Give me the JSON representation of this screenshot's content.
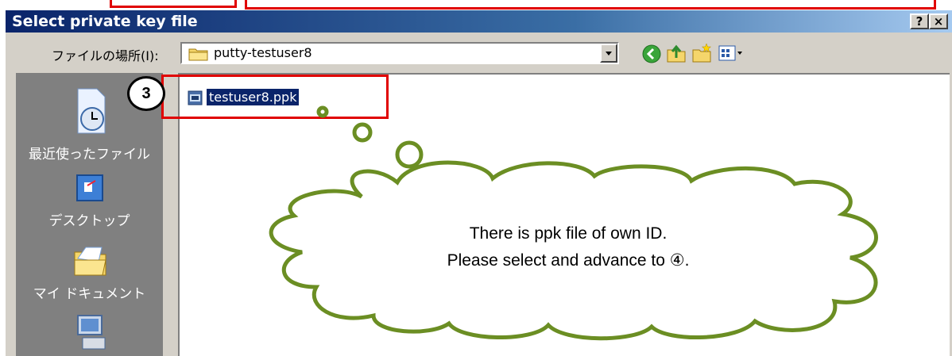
{
  "dialog": {
    "title": "Select private key file",
    "help_button": "?",
    "close_button": "×"
  },
  "toolbar": {
    "lookin_label": "ファイルの場所(I):",
    "lookin_value": "putty-testuser8",
    "icons": [
      "back-icon",
      "up-folder-icon",
      "new-folder-icon",
      "view-menu-icon"
    ]
  },
  "places": [
    {
      "label": "最近使ったファイル",
      "icon": "recent-icon"
    },
    {
      "label": "デスクトップ",
      "icon": "desktop-icon"
    },
    {
      "label": "マイ ドキュメント",
      "icon": "my-documents-icon"
    },
    {
      "label": "",
      "icon": "my-computer-icon"
    }
  ],
  "files": [
    {
      "name": "testuser8.ppk",
      "selected": true,
      "icon": "ppk-file-icon"
    }
  ],
  "annotation": {
    "step": "3",
    "callout_line1": "There is ppk file of own ID.",
    "callout_line2": "Please select and advance to ④.",
    "highlight_color": "#e00000",
    "cloud_stroke": "#6b8e23"
  }
}
